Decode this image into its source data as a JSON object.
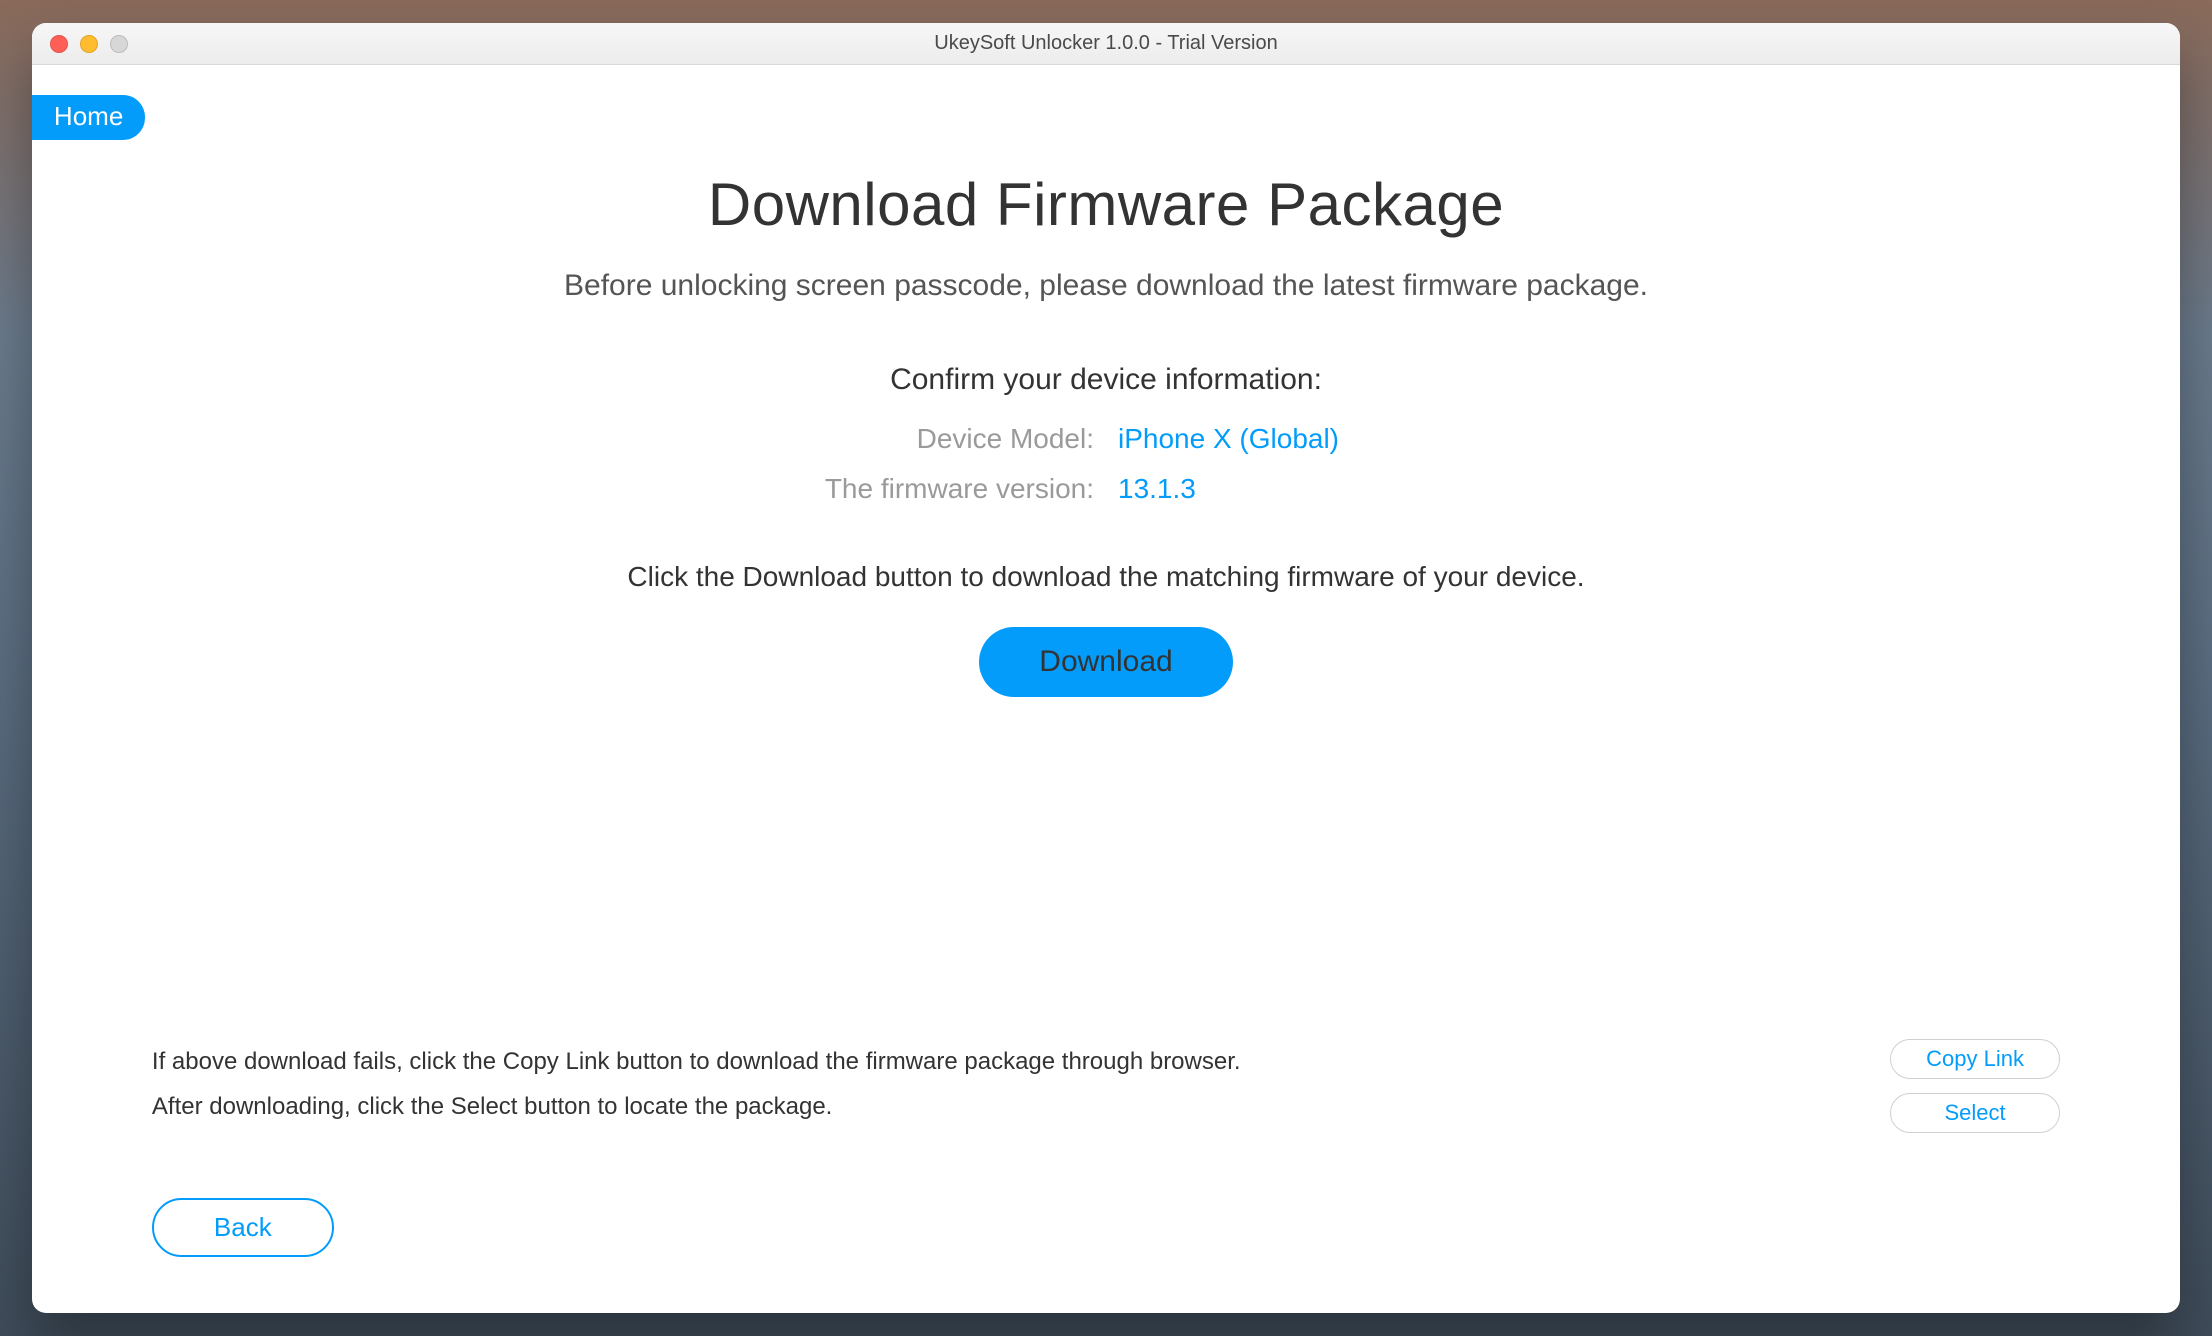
{
  "window": {
    "title": "UkeySoft Unlocker 1.0.0 - Trial Version"
  },
  "nav": {
    "home_label": "Home"
  },
  "page": {
    "title": "Download Firmware Package",
    "subtitle": "Before unlocking screen passcode, please download the latest firmware package.",
    "confirm_heading": "Confirm your device information:",
    "device_model_label": "Device Model:",
    "device_model_value": "iPhone X (Global)",
    "firmware_version_label": "The firmware version:",
    "firmware_version_value": "13.1.3",
    "instruction": "Click the Download button to download the matching firmware of your device.",
    "download_label": "Download"
  },
  "help": {
    "line1": "If above download fails, click the Copy Link button to download the firmware package through browser.",
    "line2": "After downloading, click the Select button to locate the package.",
    "copy_link_label": "Copy Link",
    "select_label": "Select"
  },
  "footer": {
    "back_label": "Back"
  }
}
